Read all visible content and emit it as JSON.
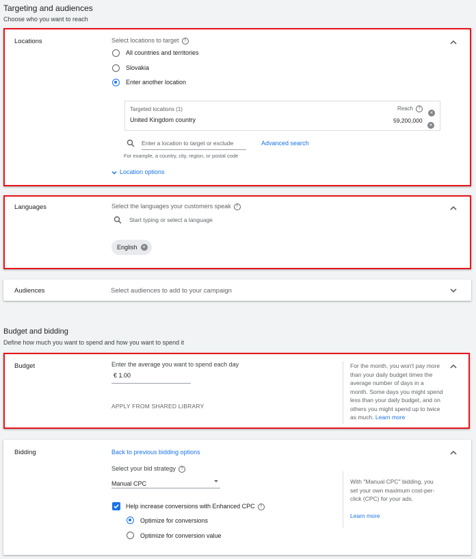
{
  "targeting": {
    "title": "Targeting and audiences",
    "subtitle": "Choose who you want to reach",
    "locations": {
      "title": "Locations",
      "prompt": "Select locations to target",
      "options": [
        "All countries and territories",
        "Slovakia",
        "Enter another location"
      ],
      "selected_index": 2,
      "targeted_header": "Targeted locations (1)",
      "reach_header": "Reach",
      "targeted_item": "United Kingdom country",
      "reach_value": "59,200,000",
      "search_placeholder": "Enter a location to target or exclude",
      "search_hint": "For example, a country, city, region, or postal code",
      "advanced_search": "Advanced search",
      "location_options": "Location options"
    },
    "languages": {
      "title": "Languages",
      "prompt": "Select the languages your customers speak",
      "search_placeholder": "Start typing or select a language",
      "chip": "English"
    },
    "audiences": {
      "title": "Audiences",
      "prompt": "Select audiences to add to your campaign"
    }
  },
  "budget_bidding": {
    "title": "Budget and bidding",
    "subtitle": "Define how much you want to spend and how you want to spend it",
    "budget": {
      "title": "Budget",
      "prompt": "Enter the average you want to spend each day",
      "currency": "€",
      "value": "1.00",
      "shared_library": "APPLY FROM SHARED LIBRARY",
      "side_text": "For the month, you won't pay more than your daily budget times the average number of days in a month. Some days you might spend less than your daily budget, and on others you might spend up to twice as much.",
      "learn_more": "Learn more"
    },
    "bidding": {
      "title": "Bidding",
      "back_link": "Back to previous bidding options",
      "strategy_label": "Select your bid strategy",
      "strategy_value": "Manual CPC",
      "ecpc_label": "Help increase conversions with Enhanced CPC",
      "ecpc_checked": true,
      "ecpc_options": [
        "Optimize for conversions",
        "Optimize for conversion value"
      ],
      "ecpc_selected_index": 0,
      "side_text": "With \"Manual CPC\" bidding, you set your own maximum cost-per-click (CPC) for your ads.",
      "learn_more": "Learn more"
    }
  },
  "colors": {
    "accent": "#1a73e8",
    "highlight": "#e8141b",
    "page_bg": "#f1f3f4"
  },
  "icons": [
    "help-icon",
    "search-icon",
    "chevron-up-icon",
    "chevron-down-icon",
    "clear-icon",
    "dropdown-arrow-icon",
    "checkbox-icon"
  ]
}
